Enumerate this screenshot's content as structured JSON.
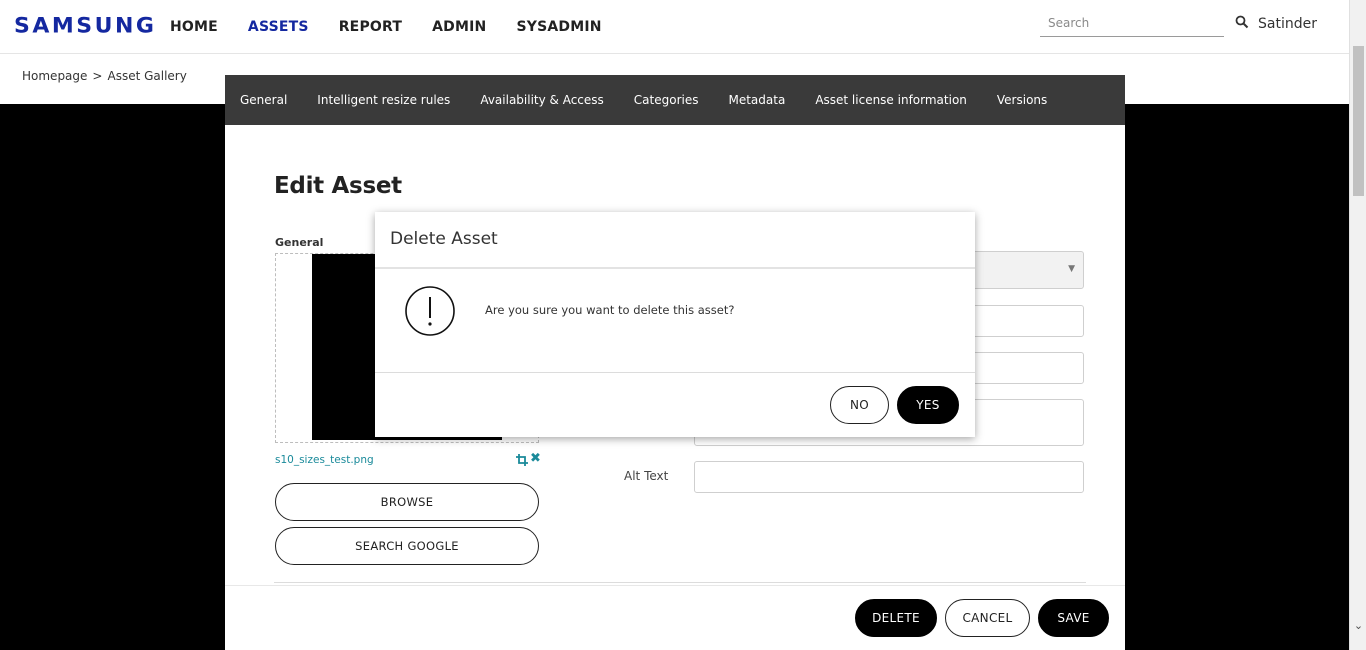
{
  "header": {
    "brand": "SAMSUNG",
    "nav": [
      {
        "label": "HOME"
      },
      {
        "label": "ASSETS",
        "active": true
      },
      {
        "label": "REPORT"
      },
      {
        "label": "ADMIN"
      },
      {
        "label": "SYSADMIN"
      }
    ],
    "search_placeholder": "Search",
    "user": "Satinder"
  },
  "breadcrumb": {
    "home": "Homepage",
    "separator": ">",
    "current": "Asset Gallery"
  },
  "editor": {
    "tabs": [
      {
        "label": "General"
      },
      {
        "label": "Intelligent resize rules"
      },
      {
        "label": "Availability & Access"
      },
      {
        "label": "Categories"
      },
      {
        "label": "Metadata"
      },
      {
        "label": "Asset license information"
      },
      {
        "label": "Versions"
      }
    ],
    "title": "Edit Asset",
    "section_label": "General",
    "file_name": "s10_sizes_test.png",
    "browse_label": "BROWSE",
    "search_google_label": "SEARCH GOOGLE",
    "alt_text_label": "Alt Text",
    "delete_label": "DELETE",
    "cancel_label": "CANCEL",
    "save_label": "SAVE"
  },
  "modal": {
    "title": "Delete Asset",
    "message": "Are you sure you want to delete this asset?",
    "no_label": "NO",
    "yes_label": "YES"
  },
  "colors": {
    "brand": "#1428a0",
    "tabbar": "#3a3a3a",
    "link": "#1a8a9a"
  }
}
